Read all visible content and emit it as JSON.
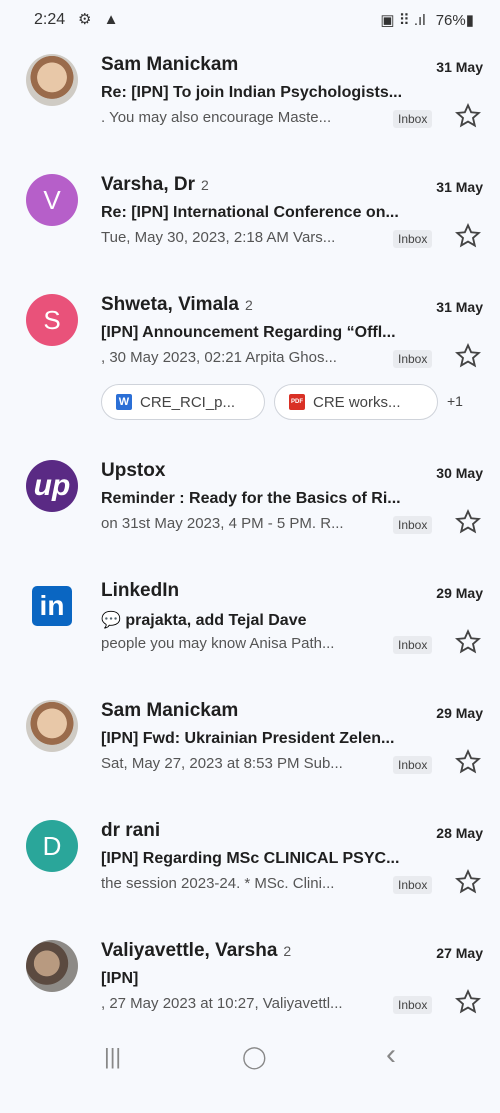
{
  "status_bar": {
    "time": "2:24",
    "left_icons": "⚙ ▲",
    "right_icons": "▣ ⠿ .ıl",
    "battery": "76%▮"
  },
  "emails": [
    {
      "sender": "Sam Manickam",
      "count": "",
      "date": "31 May",
      "subject": "Re: [IPN] To join Indian Psychologists...",
      "snippet": ". You may also encourage Maste...",
      "label": "Inbox",
      "avatar_letter": "",
      "avatar_icon": "person-photo"
    },
    {
      "sender": "Varsha, Dr",
      "count": "2",
      "date": "31 May",
      "subject": "Re: [IPN] International Conference on...",
      "snippet": "Tue, May 30, 2023, 2:18 AM Vars...",
      "label": "Inbox",
      "avatar_letter": "V",
      "avatar_color": "#b65fc9"
    },
    {
      "sender": "Shweta, Vimala",
      "count": "2",
      "date": "31 May",
      "subject": "[IPN] Announcement Regarding “Offl...",
      "snippet": ", 30 May 2023, 02:21 Arpita Ghos...",
      "label": "Inbox",
      "avatar_letter": "S",
      "avatar_color": "#e9527a",
      "attachments": [
        {
          "name": "CRE_RCI_p...",
          "icon": "W",
          "icon_color": "#2b6fd6"
        },
        {
          "name": "CRE works...",
          "icon": "PDF",
          "icon_color": "#d93025"
        }
      ],
      "more_attachments": "+1"
    },
    {
      "sender": "Upstox",
      "count": "",
      "date": "30 May",
      "subject": "Reminder : Ready for the Basics of Ri...",
      "snippet": "on 31st May 2023, 4 PM - 5 PM. R...",
      "label": "Inbox",
      "avatar_letter": "up",
      "avatar_color": "#5a2a84"
    },
    {
      "sender": "LinkedIn",
      "count": "",
      "date": "29 May",
      "subject": "💬 prajakta, add Tejal Dave",
      "snippet": "people you may know Anisa Path...",
      "label": "Inbox",
      "avatar_letter": "in",
      "avatar_color": "#0a66c2"
    },
    {
      "sender": "Sam Manickam",
      "count": "",
      "date": "29 May",
      "subject": "[IPN] Fwd: Ukrainian President Zelen...",
      "snippet": "Sat, May 27, 2023 at 8:53 PM Sub...",
      "label": "Inbox",
      "avatar_letter": "",
      "avatar_icon": "person-photo"
    },
    {
      "sender": "dr rani",
      "count": "",
      "date": "28 May",
      "subject": "[IPN] Regarding MSc CLINICAL PSYC...",
      "snippet": "the session 2023-24. * MSc. Clini...",
      "label": "Inbox",
      "avatar_letter": "D",
      "avatar_color": "#2aa69a"
    },
    {
      "sender": "Valiyavettle, Varsha",
      "count": "2",
      "date": "27 May",
      "subject": "[IPN]",
      "snippet": ", 27 May 2023 at 10:27, Valiyavettl...",
      "label": "Inbox",
      "avatar_letter": "",
      "avatar_icon": "person-photo"
    }
  ],
  "nav": {
    "recent": "|||",
    "home": "◯",
    "back": "‹"
  }
}
